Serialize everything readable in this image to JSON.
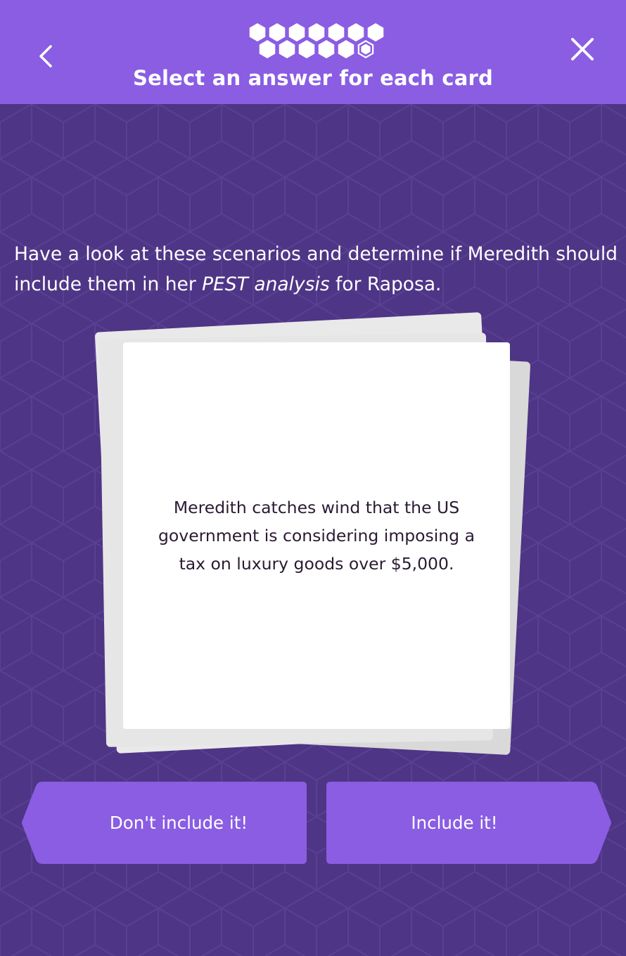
{
  "header": {
    "title": "Select an answer for each card",
    "back_icon": "chevron-left-icon",
    "close_icon": "close-icon",
    "progress": {
      "total": 13,
      "current": 12
    }
  },
  "instructions": {
    "before": "Have a look at these scenarios and determine if Meredith should include them in her ",
    "emphasis": "PEST analysis",
    "after": " for Raposa."
  },
  "card": {
    "text": "Meredith catches wind that the US government is considering imposing a tax on luxury goods over $5,000."
  },
  "buttons": {
    "dont_include": "Don't include it!",
    "include": "Include it!"
  },
  "colors": {
    "header": "#8a5de3",
    "background": "#4e3585",
    "button": "#8a5de3",
    "card": "#ffffff",
    "card_text": "#2b1a33"
  }
}
